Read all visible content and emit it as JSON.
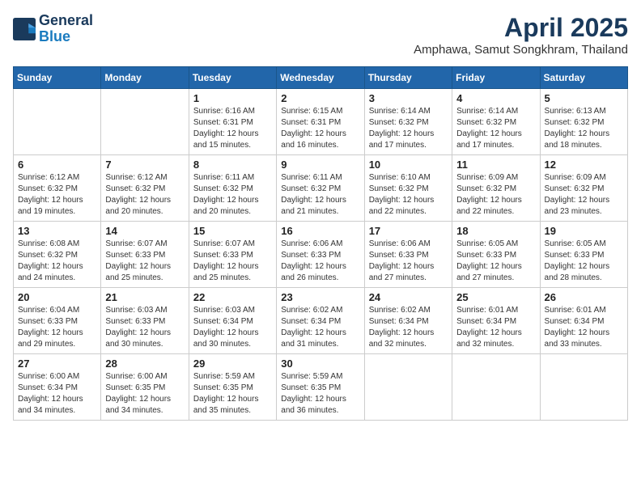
{
  "logo": {
    "line1": "General",
    "line2": "Blue"
  },
  "title": "April 2025",
  "subtitle": "Amphawa, Samut Songkhram, Thailand",
  "weekdays": [
    "Sunday",
    "Monday",
    "Tuesday",
    "Wednesday",
    "Thursday",
    "Friday",
    "Saturday"
  ],
  "weeks": [
    [
      {
        "day": "",
        "info": ""
      },
      {
        "day": "",
        "info": ""
      },
      {
        "day": "1",
        "info": "Sunrise: 6:16 AM\nSunset: 6:31 PM\nDaylight: 12 hours and 15 minutes."
      },
      {
        "day": "2",
        "info": "Sunrise: 6:15 AM\nSunset: 6:31 PM\nDaylight: 12 hours and 16 minutes."
      },
      {
        "day": "3",
        "info": "Sunrise: 6:14 AM\nSunset: 6:32 PM\nDaylight: 12 hours and 17 minutes."
      },
      {
        "day": "4",
        "info": "Sunrise: 6:14 AM\nSunset: 6:32 PM\nDaylight: 12 hours and 17 minutes."
      },
      {
        "day": "5",
        "info": "Sunrise: 6:13 AM\nSunset: 6:32 PM\nDaylight: 12 hours and 18 minutes."
      }
    ],
    [
      {
        "day": "6",
        "info": "Sunrise: 6:12 AM\nSunset: 6:32 PM\nDaylight: 12 hours and 19 minutes."
      },
      {
        "day": "7",
        "info": "Sunrise: 6:12 AM\nSunset: 6:32 PM\nDaylight: 12 hours and 20 minutes."
      },
      {
        "day": "8",
        "info": "Sunrise: 6:11 AM\nSunset: 6:32 PM\nDaylight: 12 hours and 20 minutes."
      },
      {
        "day": "9",
        "info": "Sunrise: 6:11 AM\nSunset: 6:32 PM\nDaylight: 12 hours and 21 minutes."
      },
      {
        "day": "10",
        "info": "Sunrise: 6:10 AM\nSunset: 6:32 PM\nDaylight: 12 hours and 22 minutes."
      },
      {
        "day": "11",
        "info": "Sunrise: 6:09 AM\nSunset: 6:32 PM\nDaylight: 12 hours and 22 minutes."
      },
      {
        "day": "12",
        "info": "Sunrise: 6:09 AM\nSunset: 6:32 PM\nDaylight: 12 hours and 23 minutes."
      }
    ],
    [
      {
        "day": "13",
        "info": "Sunrise: 6:08 AM\nSunset: 6:32 PM\nDaylight: 12 hours and 24 minutes."
      },
      {
        "day": "14",
        "info": "Sunrise: 6:07 AM\nSunset: 6:33 PM\nDaylight: 12 hours and 25 minutes."
      },
      {
        "day": "15",
        "info": "Sunrise: 6:07 AM\nSunset: 6:33 PM\nDaylight: 12 hours and 25 minutes."
      },
      {
        "day": "16",
        "info": "Sunrise: 6:06 AM\nSunset: 6:33 PM\nDaylight: 12 hours and 26 minutes."
      },
      {
        "day": "17",
        "info": "Sunrise: 6:06 AM\nSunset: 6:33 PM\nDaylight: 12 hours and 27 minutes."
      },
      {
        "day": "18",
        "info": "Sunrise: 6:05 AM\nSunset: 6:33 PM\nDaylight: 12 hours and 27 minutes."
      },
      {
        "day": "19",
        "info": "Sunrise: 6:05 AM\nSunset: 6:33 PM\nDaylight: 12 hours and 28 minutes."
      }
    ],
    [
      {
        "day": "20",
        "info": "Sunrise: 6:04 AM\nSunset: 6:33 PM\nDaylight: 12 hours and 29 minutes."
      },
      {
        "day": "21",
        "info": "Sunrise: 6:03 AM\nSunset: 6:33 PM\nDaylight: 12 hours and 30 minutes."
      },
      {
        "day": "22",
        "info": "Sunrise: 6:03 AM\nSunset: 6:34 PM\nDaylight: 12 hours and 30 minutes."
      },
      {
        "day": "23",
        "info": "Sunrise: 6:02 AM\nSunset: 6:34 PM\nDaylight: 12 hours and 31 minutes."
      },
      {
        "day": "24",
        "info": "Sunrise: 6:02 AM\nSunset: 6:34 PM\nDaylight: 12 hours and 32 minutes."
      },
      {
        "day": "25",
        "info": "Sunrise: 6:01 AM\nSunset: 6:34 PM\nDaylight: 12 hours and 32 minutes."
      },
      {
        "day": "26",
        "info": "Sunrise: 6:01 AM\nSunset: 6:34 PM\nDaylight: 12 hours and 33 minutes."
      }
    ],
    [
      {
        "day": "27",
        "info": "Sunrise: 6:00 AM\nSunset: 6:34 PM\nDaylight: 12 hours and 34 minutes."
      },
      {
        "day": "28",
        "info": "Sunrise: 6:00 AM\nSunset: 6:35 PM\nDaylight: 12 hours and 34 minutes."
      },
      {
        "day": "29",
        "info": "Sunrise: 5:59 AM\nSunset: 6:35 PM\nDaylight: 12 hours and 35 minutes."
      },
      {
        "day": "30",
        "info": "Sunrise: 5:59 AM\nSunset: 6:35 PM\nDaylight: 12 hours and 36 minutes."
      },
      {
        "day": "",
        "info": ""
      },
      {
        "day": "",
        "info": ""
      },
      {
        "day": "",
        "info": ""
      }
    ]
  ]
}
